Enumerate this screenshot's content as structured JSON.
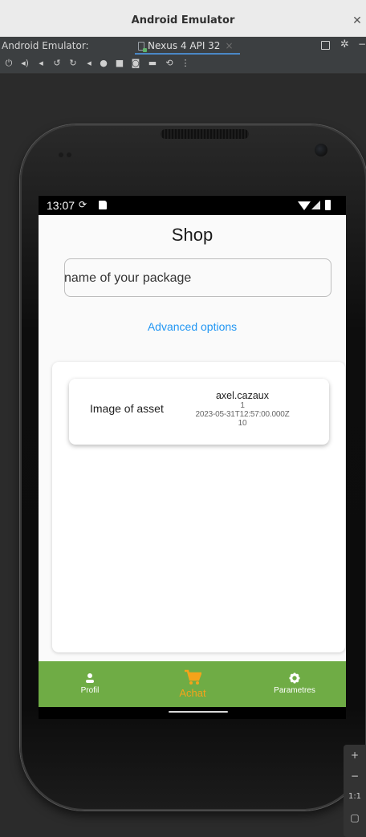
{
  "window": {
    "title": "Android Emulator"
  },
  "tabbar": {
    "label": "Android Emulator:",
    "device_tab": "Nexus 4 API 32"
  },
  "statusbar": {
    "time": "13:07"
  },
  "app": {
    "title": "Shop",
    "search_placeholder": "name of your package",
    "advanced_link": "Advanced options",
    "assets": [
      {
        "image_label": "Image of asset",
        "owner": "axel.cazaux",
        "quantity": "1",
        "date": "2023-05-31T12:57:00.000Z",
        "price": "10"
      }
    ],
    "nav": [
      {
        "label": "Profil",
        "icon": "person-icon",
        "active": false
      },
      {
        "label": "Achat",
        "icon": "cart-icon",
        "active": true
      },
      {
        "label": "Parametres",
        "icon": "gear-icon",
        "active": false
      }
    ]
  },
  "zoom": {
    "plus": "+",
    "minus": "−",
    "one_to_one": "1:1"
  },
  "colors": {
    "nav_bg": "#6fac45",
    "nav_active": "#f5a31a",
    "link": "#2196f3"
  }
}
